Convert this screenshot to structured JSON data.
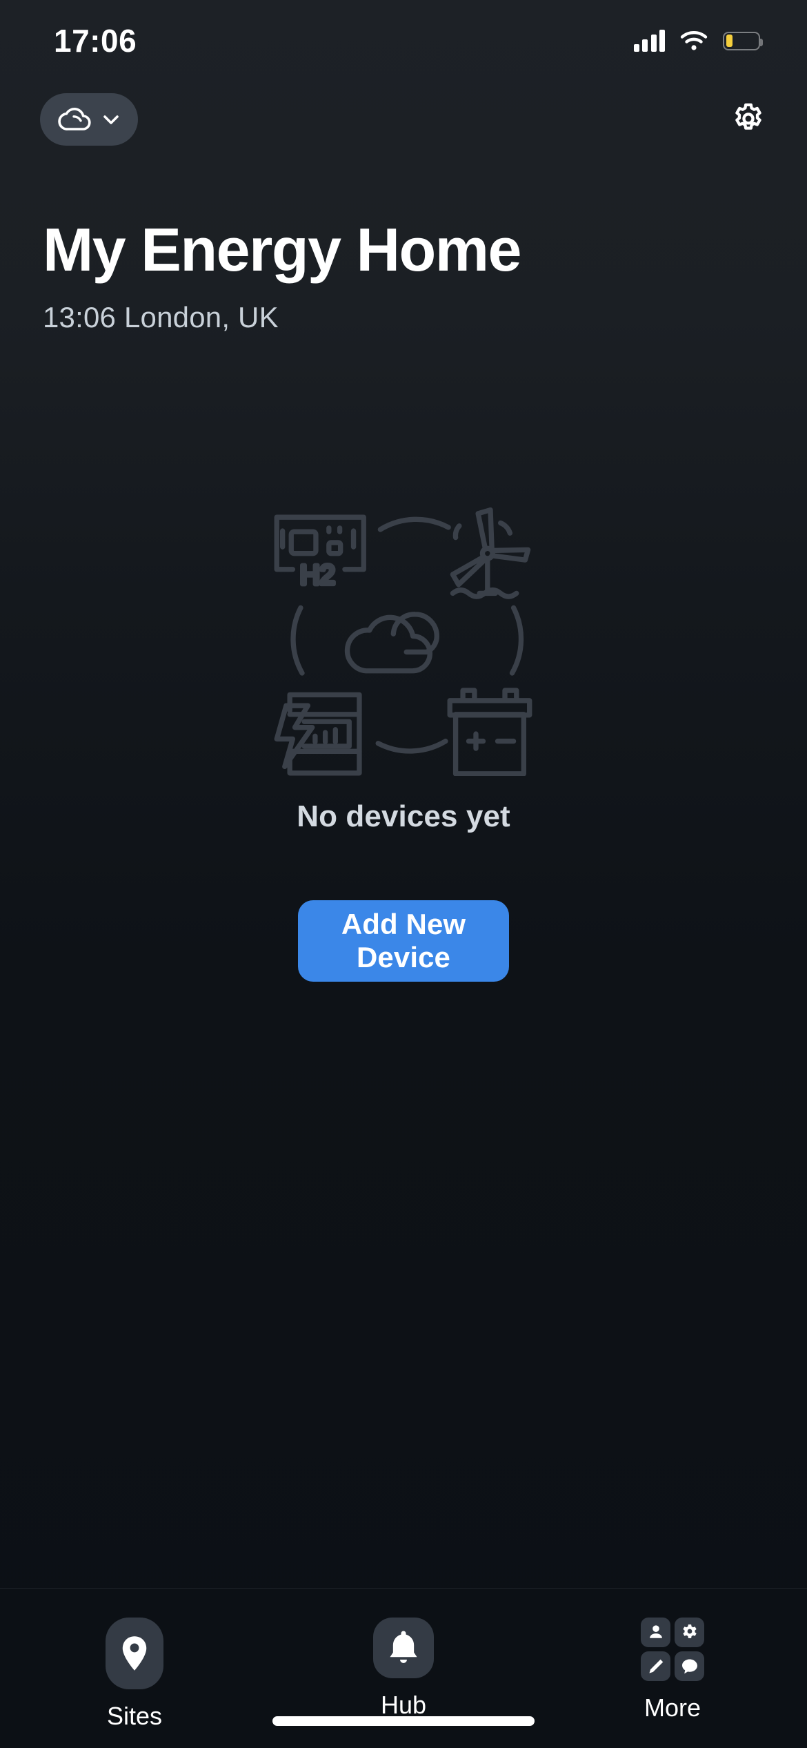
{
  "status_bar": {
    "time": "17:06",
    "cellular_icon": "signal-bars-icon",
    "wifi_icon": "wifi-icon",
    "battery_icon": "battery-low-icon",
    "battery_level_percent": 22,
    "battery_color": "#f5cf3d"
  },
  "toolbar": {
    "cloud_chip": {
      "icon": "cloud-icon",
      "chevron": "chevron-down-icon",
      "label": ""
    },
    "settings_icon": "gear-icon"
  },
  "header": {
    "title": "My Energy Home",
    "subtitle": "13:06 London, UK"
  },
  "empty_state": {
    "illustration_icons": [
      "hydrogen-electrolyzer-icon",
      "wind-turbine-icon",
      "cloud-icon",
      "electricity-meter-icon",
      "battery-icon"
    ],
    "illustration_label": "H2",
    "message": "No devices yet",
    "button_label": "Add New Device",
    "button_color": "#3b87e8"
  },
  "tab_bar": {
    "items": [
      {
        "label": "Sites",
        "icon": "location-pin-icon",
        "active": true
      },
      {
        "label": "Hub",
        "icon": "bell-icon",
        "active": false
      },
      {
        "label": "More",
        "icon": "more-grid-icon",
        "active": false
      }
    ],
    "more_grid_icons": [
      "person-icon",
      "gear-icon",
      "pencil-icon",
      "chat-bubble-icon"
    ]
  }
}
